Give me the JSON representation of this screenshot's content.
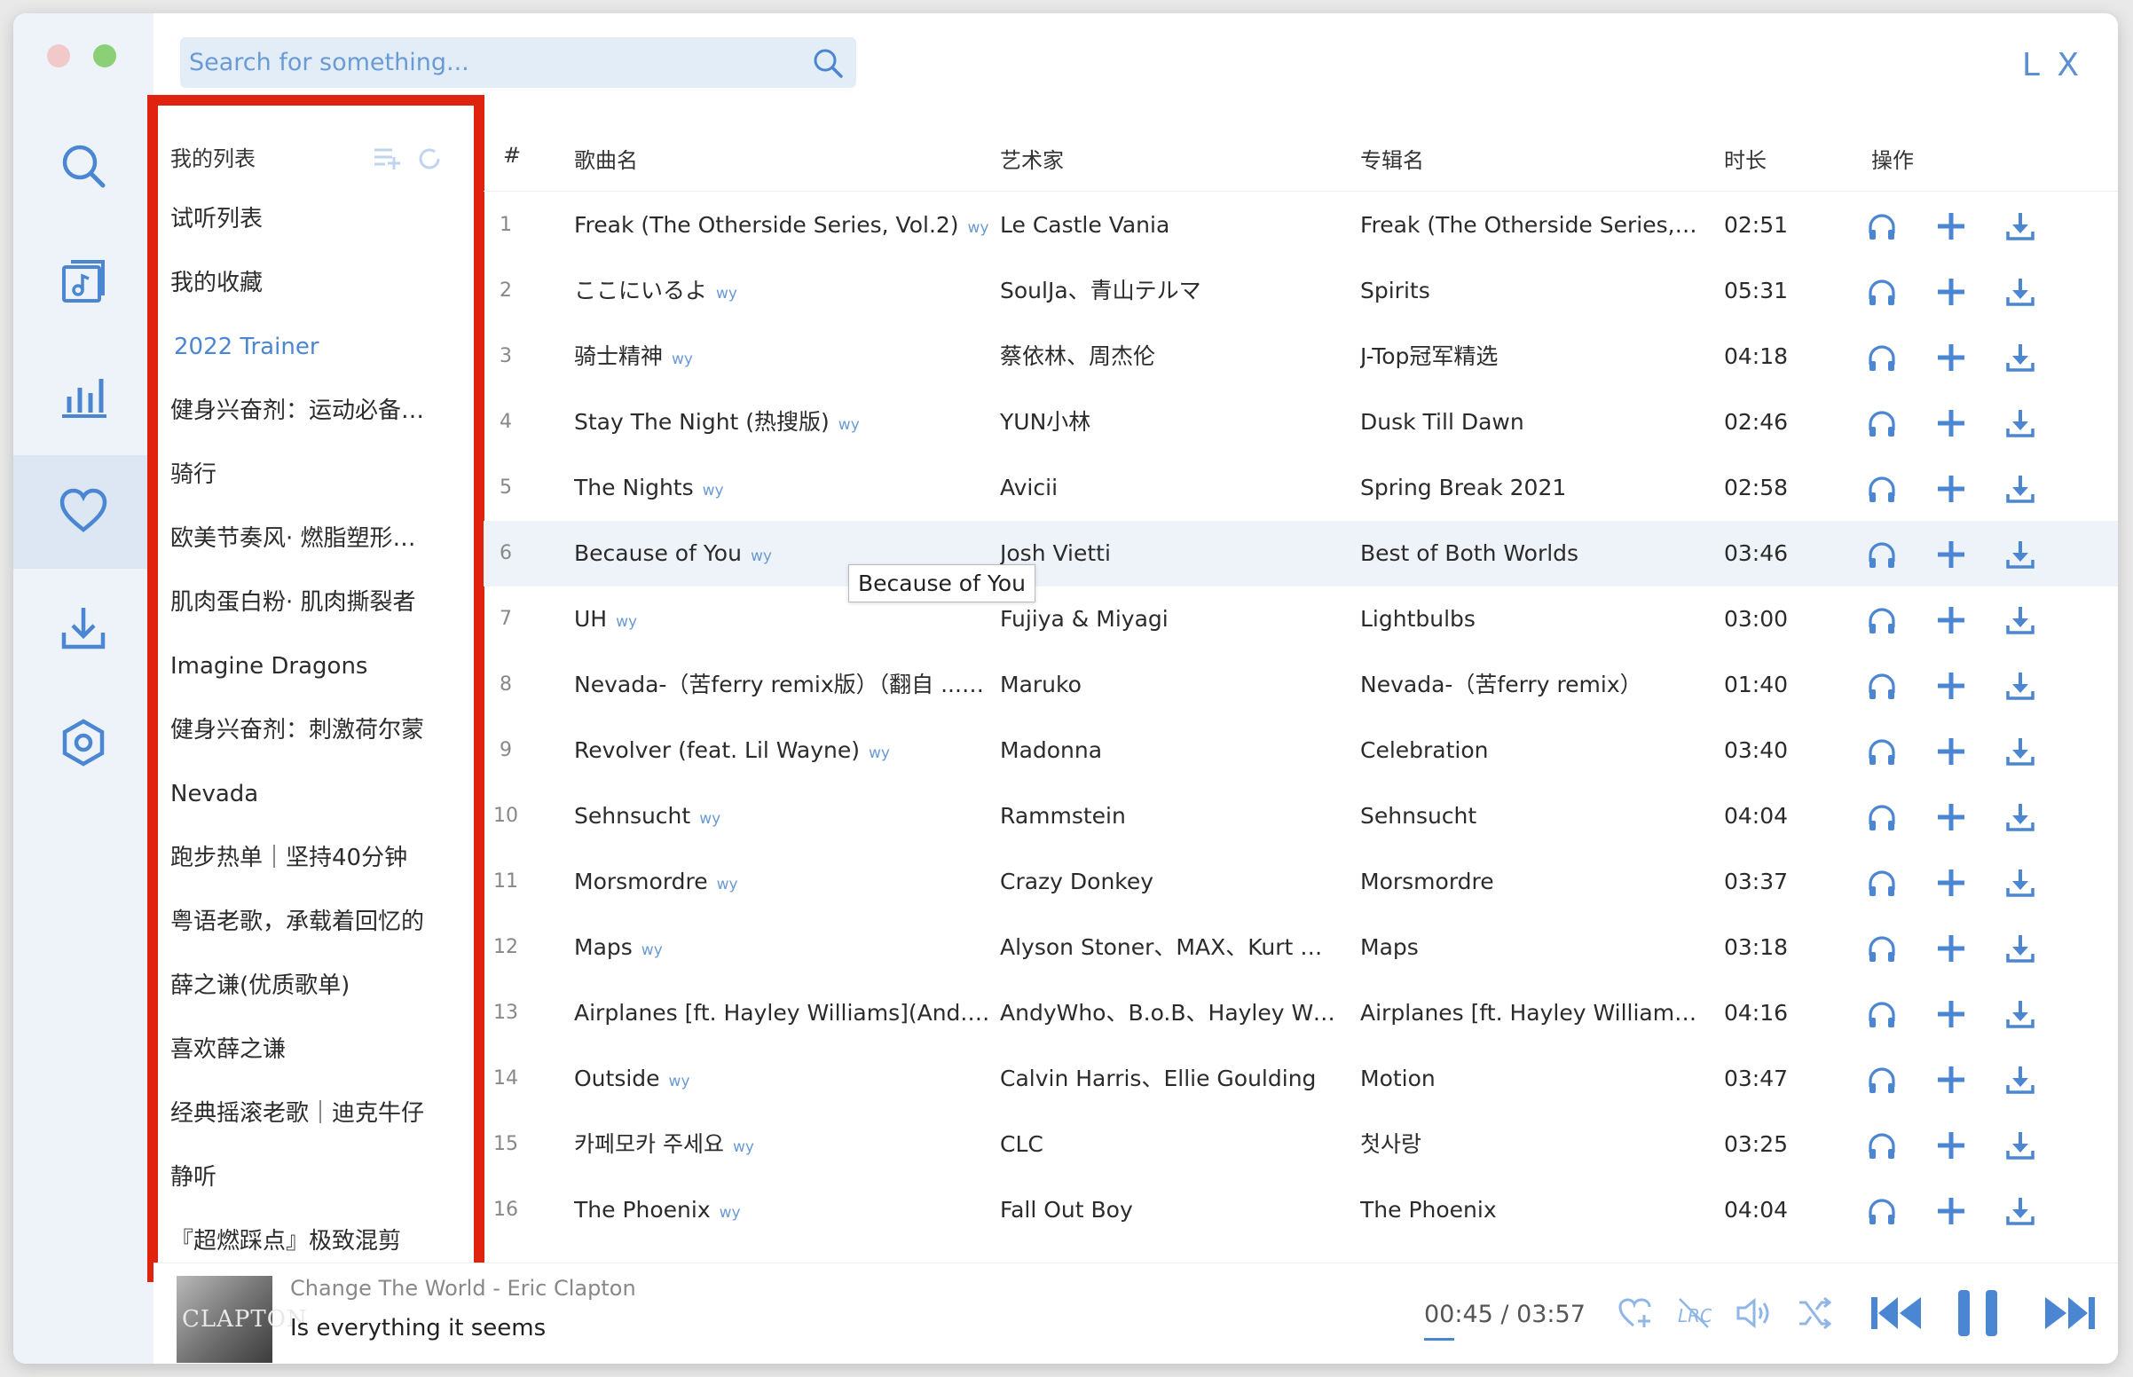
{
  "app": {
    "brand": "L X"
  },
  "search": {
    "placeholder": "Search for something..."
  },
  "nav": [
    {
      "name": "search",
      "icon": "search-icon"
    },
    {
      "name": "song-list",
      "icon": "music-list-icon"
    },
    {
      "name": "leaderboard",
      "icon": "bar-chart-icon"
    },
    {
      "name": "my-list",
      "icon": "heart-icon",
      "active": true
    },
    {
      "name": "download",
      "icon": "download-icon"
    },
    {
      "name": "settings",
      "icon": "settings-icon"
    }
  ],
  "playlists": {
    "header": "我的列表",
    "items": [
      {
        "label": "试听列表"
      },
      {
        "label": "我的收藏"
      },
      {
        "label": "2022 Trainer",
        "active": true
      },
      {
        "label": "健身兴奋剂：运动必备粤语"
      },
      {
        "label": "骑行"
      },
      {
        "label": "欧美节奏风· 燃脂塑形必备"
      },
      {
        "label": "肌肉蛋白粉· 肌肉撕裂者"
      },
      {
        "label": "Imagine Dragons"
      },
      {
        "label": "健身兴奋剂：刺激荷尔蒙"
      },
      {
        "label": "Nevada"
      },
      {
        "label": "跑步热单｜坚持40分钟"
      },
      {
        "label": "粤语老歌，承载着回忆的"
      },
      {
        "label": "薛之谦(优质歌单)"
      },
      {
        "label": "喜欢薛之谦"
      },
      {
        "label": "经典摇滚老歌｜迪克牛仔"
      },
      {
        "label": "静听"
      },
      {
        "label": "『超燃踩点』极致混剪"
      }
    ]
  },
  "table": {
    "headers": {
      "num": "#",
      "name": "歌曲名",
      "artist": "艺术家",
      "album": "专辑名",
      "duration": "时长",
      "actions": "操作"
    },
    "rows": [
      {
        "num": "1",
        "name": "Freak (The Otherside Series, Vol.2)",
        "source": "wy",
        "artist": "Le Castle Vania",
        "album": "Freak (The Otherside Series, Vol...",
        "duration": "02:51"
      },
      {
        "num": "2",
        "name": "ここにいるよ",
        "source": "wy",
        "artist": "SoulJa、青山テルマ",
        "album": "Spirits",
        "duration": "05:31"
      },
      {
        "num": "3",
        "name": "骑士精神",
        "source": "wy",
        "artist": "蔡依林、周杰伦",
        "album": "J-Top冠军精选",
        "duration": "04:18"
      },
      {
        "num": "4",
        "name": "Stay The Night (热搜版)",
        "source": "wy",
        "artist": "YUN小林",
        "album": "Dusk Till Dawn",
        "duration": "02:46"
      },
      {
        "num": "5",
        "name": "The Nights",
        "source": "wy",
        "artist": "Avicii",
        "album": "Spring Break 2021",
        "duration": "02:58"
      },
      {
        "num": "6",
        "name": "Because of You",
        "source": "wy",
        "artist": "Josh Vietti",
        "album": "Best of Both Worlds",
        "duration": "03:46",
        "hover": true
      },
      {
        "num": "7",
        "name": "UH",
        "source": "wy",
        "artist": "Fujiya & Miyagi",
        "album": "Lightbulbs",
        "duration": "03:00"
      },
      {
        "num": "8",
        "name": "Nevada-（苦ferry remix版）（翻自 ...",
        "source": "wy",
        "artist": "Maruko",
        "album": "Nevada-（苦ferry remix）",
        "duration": "01:40"
      },
      {
        "num": "9",
        "name": "Revolver (feat. Lil Wayne)",
        "source": "wy",
        "artist": "Madonna",
        "album": "Celebration",
        "duration": "03:40"
      },
      {
        "num": "10",
        "name": "Sehnsucht",
        "source": "wy",
        "artist": "Rammstein",
        "album": "Sehnsucht",
        "duration": "04:04"
      },
      {
        "num": "11",
        "name": "Morsmordre",
        "source": "wy",
        "artist": "Crazy Donkey",
        "album": "Morsmordre",
        "duration": "03:37"
      },
      {
        "num": "12",
        "name": "Maps",
        "source": "wy",
        "artist": "Alyson Stoner、MAX、Kurt Hug...",
        "album": "Maps",
        "duration": "03:18"
      },
      {
        "num": "13",
        "name": "Airplanes [ft. Hayley Williams](And...",
        "source": "wy",
        "artist": "AndyWho、B.o.B、Hayley Willia...",
        "album": "Airplanes [ft. Hayley Williams](A...",
        "duration": "04:16"
      },
      {
        "num": "14",
        "name": "Outside",
        "source": "wy",
        "artist": "Calvin Harris、Ellie Goulding",
        "album": "Motion",
        "duration": "03:47"
      },
      {
        "num": "15",
        "name": "카페모카 주세요",
        "source": "wy",
        "artist": "CLC",
        "album": "첫사랑",
        "duration": "03:25"
      },
      {
        "num": "16",
        "name": "The Phoenix",
        "source": "wy",
        "artist": "Fall Out Boy",
        "album": "The Phoenix",
        "duration": "04:04"
      }
    ],
    "tooltip": "Because of You"
  },
  "player": {
    "cover_text": "CLAPTON",
    "title": "Change The World - Eric Clapton",
    "lyric": "Is everything it seems",
    "time": "00:45 / 03:57",
    "progress": 0.19
  },
  "colors": {
    "accent": "#4a86d2",
    "highlight_border": "#e0230f",
    "sidebar_bg": "#eef3f9"
  }
}
